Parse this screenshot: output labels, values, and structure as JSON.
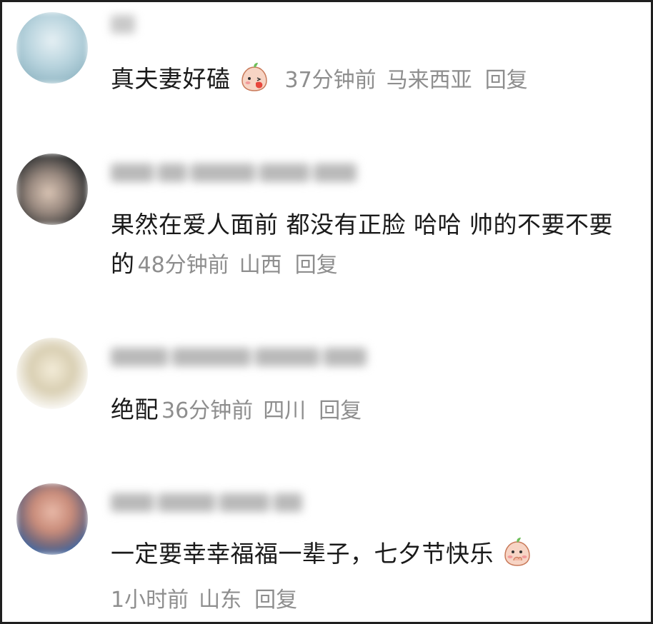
{
  "comments": [
    {
      "text": "真夫妻好磕",
      "emoji": "peach-blush-emoji",
      "time": "37分钟前",
      "location": "马来西亚",
      "reply": "回复"
    },
    {
      "text": "果然在爱人面前 都没有正脸 哈哈 帅的不要不要的",
      "time": "48分钟前",
      "location": "山西",
      "reply": "回复"
    },
    {
      "text": "绝配",
      "time": "36分钟前",
      "location": "四川",
      "reply": "回复"
    },
    {
      "text": "一定要幸幸福福一辈子，七夕节快乐",
      "emoji": "peach-shy-emoji",
      "time": "1小时前",
      "location": "山东",
      "reply": "回复"
    }
  ]
}
